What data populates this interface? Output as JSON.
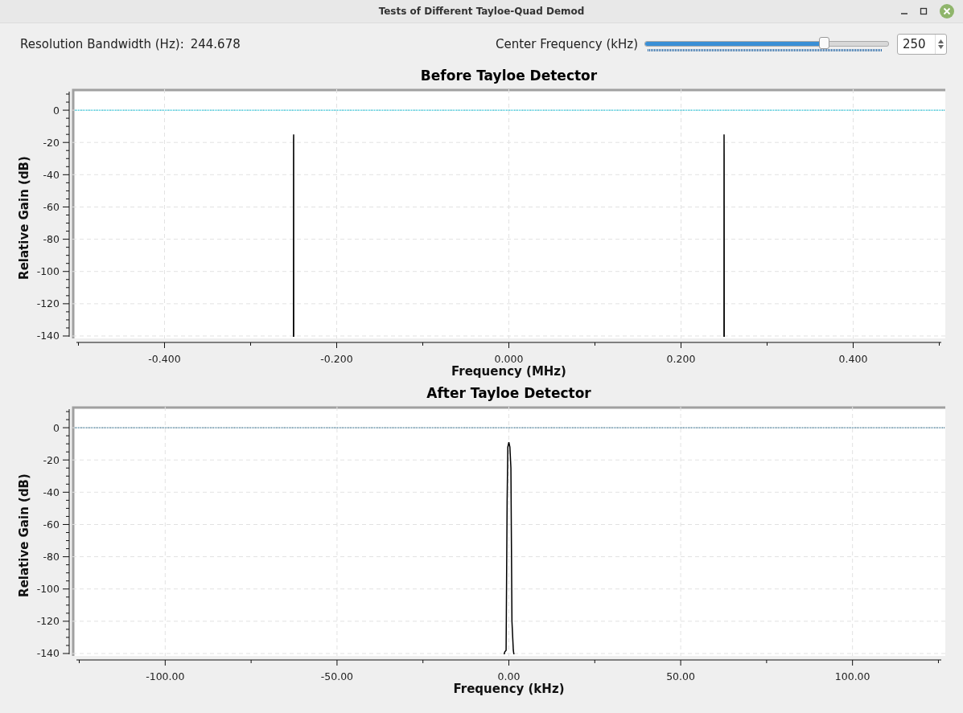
{
  "window": {
    "title": "Tests of Different Tayloe-Quad Demod"
  },
  "resolution": {
    "label": "Resolution Bandwidth (Hz):",
    "value": "244.678"
  },
  "center_frequency": {
    "label": "Center Frequency (kHz)",
    "level": 0.74,
    "value": "250"
  },
  "plots": [
    {
      "chart_data": {
        "type": "line",
        "title": "Before Tayloe Detector",
        "xlabel": "Frequency (MHz)",
        "ylabel": "Relative Gain (dB)",
        "grid": true,
        "xlim": [
          -0.507,
          0.507
        ],
        "ylim": [
          -141.5,
          13
        ],
        "xticks": [
          {
            "value": -0.4,
            "label": "-0.400"
          },
          {
            "value": -0.2,
            "label": "-0.200"
          },
          {
            "value": 0,
            "label": "0.000"
          },
          {
            "value": 0.2,
            "label": "0.200"
          },
          {
            "value": 0.4,
            "label": "0.400"
          }
        ],
        "yticks": [
          0,
          -20,
          -40,
          -60,
          -80,
          -100,
          -120,
          -140
        ],
        "x": [
          -0.2502,
          -0.2501,
          -0.25,
          -0.2499,
          null,
          0.2499,
          0.25,
          0.2501,
          0.2502
        ],
        "values": [
          -141,
          -19,
          -15,
          -141,
          null,
          -141,
          -15,
          -29,
          -141
        ],
        "ref_lines": [
          {
            "axis": "y",
            "value": 0,
            "color": "#00bcd4"
          }
        ]
      }
    },
    {
      "chart_data": {
        "type": "line",
        "title": "After Tayloe Detector",
        "xlabel": "Frequency (kHz)",
        "ylabel": "Relative Gain (dB)",
        "grid": true,
        "xlim": [
          -127,
          127
        ],
        "ylim": [
          -141.5,
          13
        ],
        "xticks": [
          {
            "value": -100,
            "label": "-100.00"
          },
          {
            "value": -50,
            "label": "-50.00"
          },
          {
            "value": 0,
            "label": "0.00"
          },
          {
            "value": 50,
            "label": "50.00"
          },
          {
            "value": 100,
            "label": "100.00"
          }
        ],
        "yticks": [
          0,
          -20,
          -40,
          -60,
          -80,
          -100,
          -120,
          -140
        ],
        "x": [
          -1.4,
          -1.2,
          -0.8,
          -0.5,
          -0.3,
          0,
          0.3,
          0.6,
          0.9,
          1.3,
          1.5
        ],
        "values": [
          -141,
          -139,
          -138,
          -45,
          -12,
          -9,
          -12,
          -25,
          -120,
          -138,
          -141
        ],
        "ref_lines": [
          {
            "axis": "y",
            "value": 0,
            "color": "#2a6a8a"
          }
        ]
      }
    }
  ]
}
